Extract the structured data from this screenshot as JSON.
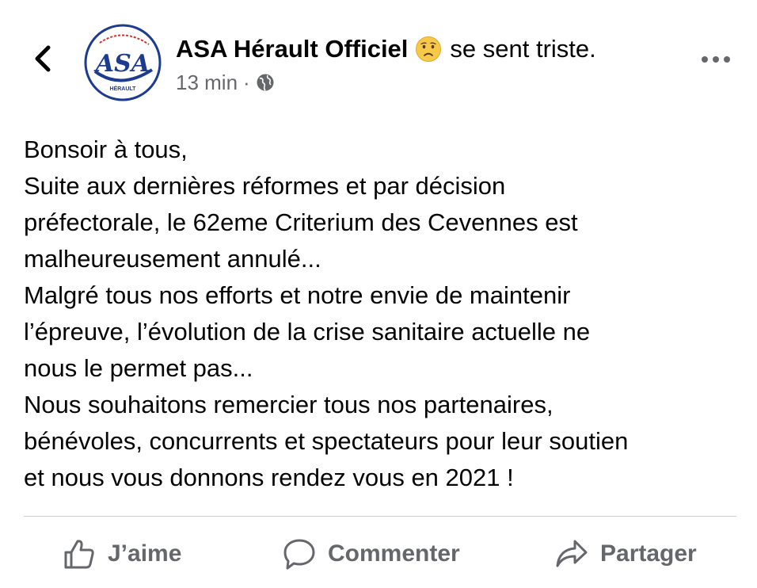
{
  "header": {
    "page_name": "ASA Hérault Officiel",
    "feeling_emoji": "sad-face-emoji",
    "feeling_text": "se sent triste.",
    "time": "13 min",
    "separator": "·",
    "audience_icon": "globe-icon",
    "avatar": {
      "logo_text": "ASA",
      "logo_subtext": "HÉRAULT",
      "colors": {
        "primary": "#1d3b8f",
        "accent": "#d62c2c"
      }
    }
  },
  "post": {
    "lines": [
      "Bonsoir à tous,",
      "Suite aux dernières réformes et par décision",
      "préfectorale, le 62eme Criterium des Cevennes est",
      "malheureusement annulé...",
      "Malgré tous nos efforts et notre envie de maintenir",
      "l’épreuve, l’évolution de la crise sanitaire actuelle ne",
      "nous le permet pas...",
      "Nous souhaitons remercier tous nos partenaires,",
      "bénévoles, concurrents et spectateurs pour leur soutien",
      "et nous vous donnons rendez vous en 2021 !"
    ]
  },
  "actions": {
    "like_label": "J’aime",
    "comment_label": "Commenter",
    "share_label": "Partager"
  },
  "icons": {
    "back": "chevron-left-icon",
    "more": "more-horizontal-icon",
    "like": "thumbs-up-icon",
    "comment": "comment-bubble-icon",
    "share": "share-arrow-icon"
  },
  "colors": {
    "text": "#050505",
    "secondary_text": "#65676b",
    "divider": "#ced0d4",
    "emoji_face": "#f7c948"
  }
}
